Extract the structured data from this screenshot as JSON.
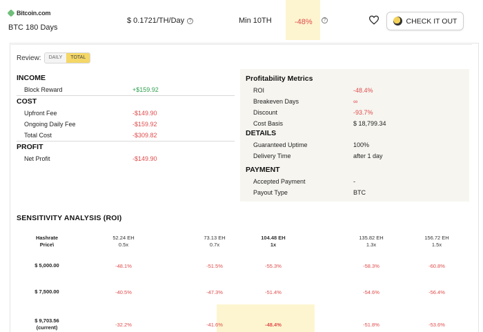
{
  "header": {
    "brand": "Bitcoin.com",
    "plan_name": "BTC 180 Days",
    "price": "$ 0.1721/TH/Day",
    "min": "Min 10TH",
    "roi": "-48%",
    "help_symbol": "?",
    "cta_label": "CHECK IT OUT"
  },
  "review": {
    "label": "Review:",
    "options": [
      "DAILY",
      "TOTAL"
    ],
    "selected": "TOTAL"
  },
  "income": {
    "title": "INCOME",
    "rows": [
      {
        "label": "Block Reward",
        "value": "+$159.92"
      }
    ]
  },
  "cost": {
    "title": "COST",
    "rows": [
      {
        "label": "Upfront Fee",
        "value": "-$149.90"
      },
      {
        "label": "Ongoing Daily Fee",
        "value": "-$159.92"
      },
      {
        "label": "Total Cost",
        "value": "-$309.82"
      }
    ]
  },
  "profit": {
    "title": "PROFIT",
    "rows": [
      {
        "label": "Net Profit",
        "value": "-$149.90"
      }
    ]
  },
  "metrics": {
    "title": "Profitability Metrics",
    "rows": [
      {
        "label": "ROI",
        "value": "-48.4%"
      },
      {
        "label": "Breakeven Days",
        "value": "∞"
      },
      {
        "label": "Discount",
        "value": "-93.7%"
      },
      {
        "label": "Cost Basis",
        "value": "$ 18,799.34"
      }
    ]
  },
  "details": {
    "title": "DETAILS",
    "rows": [
      {
        "label": "Guaranteed Uptime",
        "value": "100%"
      },
      {
        "label": "Delivery Time",
        "value": "after 1 day"
      }
    ]
  },
  "payment": {
    "title": "PAYMENT",
    "rows": [
      {
        "label": "Accepted Payment",
        "value": "-"
      },
      {
        "label": "Payout Type",
        "value": "BTC"
      }
    ]
  },
  "sensitivity": {
    "title": "SENSITIVITY ANALYSIS (ROI)",
    "corner_line1": "Hashrate",
    "corner_line2": "Price\\",
    "columns": [
      {
        "hashrate": "52.24 EH",
        "mult": "0.5x"
      },
      {
        "hashrate": "73.13 EH",
        "mult": "0.7x"
      },
      {
        "hashrate": "104.48 EH",
        "mult": "1x"
      },
      {
        "hashrate": "135.82 EH",
        "mult": "1.3x"
      },
      {
        "hashrate": "156.72 EH",
        "mult": "1.5x"
      }
    ],
    "rows": [
      {
        "price": "$ 5,000.00",
        "price_note": "",
        "values": [
          "-48.1%",
          "-51.5%",
          "-55.3%",
          "-58.3%",
          "-60.8%"
        ]
      },
      {
        "price": "$ 7,500.00",
        "price_note": "",
        "values": [
          "-40.5%",
          "-47.3%",
          "-51.4%",
          "-54.6%",
          "-56.4%"
        ]
      },
      {
        "price": "$ 9,703.56",
        "price_note": "(current)",
        "values": [
          "-32.2%",
          "-41.6%",
          "-48.4%",
          "-51.8%",
          "-53.6%"
        ]
      }
    ]
  }
}
